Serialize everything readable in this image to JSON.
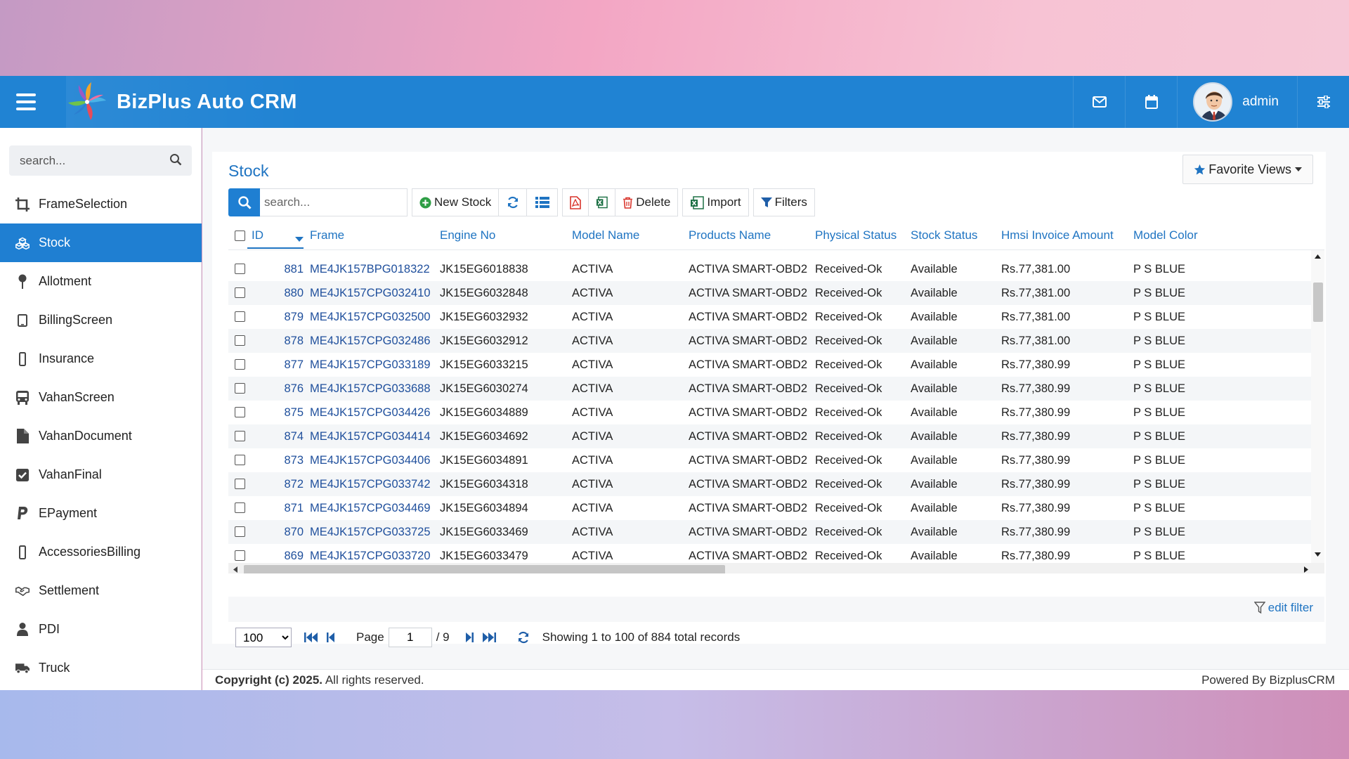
{
  "app": {
    "title": "BizPlus Auto CRM",
    "user": "admin"
  },
  "colors": {
    "primary": "#2083d3",
    "link": "#1f74c2"
  },
  "sidebar": {
    "search_placeholder": "search...",
    "items": [
      {
        "label": "FrameSelection",
        "icon": "crop-icon"
      },
      {
        "label": "Stock",
        "icon": "cubes-icon",
        "active": true
      },
      {
        "label": "Allotment",
        "icon": "pin-icon"
      },
      {
        "label": "BillingScreen",
        "icon": "tablet-icon"
      },
      {
        "label": "Insurance",
        "icon": "mobile-icon"
      },
      {
        "label": "VahanScreen",
        "icon": "bus-icon"
      },
      {
        "label": "VahanDocument",
        "icon": "file-icon"
      },
      {
        "label": "VahanFinal",
        "icon": "check-square-icon"
      },
      {
        "label": "EPayment",
        "icon": "paypal-icon"
      },
      {
        "label": "AccessoriesBilling",
        "icon": "mobile-icon"
      },
      {
        "label": "Settlement",
        "icon": "handshake-icon"
      },
      {
        "label": "PDI",
        "icon": "user-icon"
      },
      {
        "label": "Truck",
        "icon": "truck-icon"
      }
    ]
  },
  "main": {
    "title": "Stock",
    "favorite_views": "Favorite Views",
    "toolbar": {
      "search_placeholder": "search...",
      "new_stock": "New Stock",
      "delete": "Delete",
      "import": "Import",
      "filters": "Filters"
    },
    "columns": [
      "ID",
      "Frame",
      "Engine No",
      "Model Name",
      "Products Name",
      "Physical Status",
      "Stock Status",
      "Hmsi Invoice Amount",
      "Model Color"
    ],
    "rows": [
      {
        "id": "881",
        "frame": "ME4JK157BPG018322",
        "engine": "JK15EG6018838",
        "model": "ACTIVA",
        "product": "ACTIVA SMART-OBD2",
        "physical": "Received-Ok",
        "stock": "Available",
        "amount": "Rs.77,381.00",
        "color": "P S BLUE"
      },
      {
        "id": "880",
        "frame": "ME4JK157CPG032410",
        "engine": "JK15EG6032848",
        "model": "ACTIVA",
        "product": "ACTIVA SMART-OBD2",
        "physical": "Received-Ok",
        "stock": "Available",
        "amount": "Rs.77,381.00",
        "color": "P S BLUE"
      },
      {
        "id": "879",
        "frame": "ME4JK157CPG032500",
        "engine": "JK15EG6032932",
        "model": "ACTIVA",
        "product": "ACTIVA SMART-OBD2",
        "physical": "Received-Ok",
        "stock": "Available",
        "amount": "Rs.77,381.00",
        "color": "P S BLUE"
      },
      {
        "id": "878",
        "frame": "ME4JK157CPG032486",
        "engine": "JK15EG6032912",
        "model": "ACTIVA",
        "product": "ACTIVA SMART-OBD2",
        "physical": "Received-Ok",
        "stock": "Available",
        "amount": "Rs.77,381.00",
        "color": "P S BLUE"
      },
      {
        "id": "877",
        "frame": "ME4JK157CPG033189",
        "engine": "JK15EG6033215",
        "model": "ACTIVA",
        "product": "ACTIVA SMART-OBD2",
        "physical": "Received-Ok",
        "stock": "Available",
        "amount": "Rs.77,380.99",
        "color": "P S BLUE"
      },
      {
        "id": "876",
        "frame": "ME4JK157CPG033688",
        "engine": "JK15EG6030274",
        "model": "ACTIVA",
        "product": "ACTIVA SMART-OBD2",
        "physical": "Received-Ok",
        "stock": "Available",
        "amount": "Rs.77,380.99",
        "color": "P S BLUE"
      },
      {
        "id": "875",
        "frame": "ME4JK157CPG034426",
        "engine": "JK15EG6034889",
        "model": "ACTIVA",
        "product": "ACTIVA SMART-OBD2",
        "physical": "Received-Ok",
        "stock": "Available",
        "amount": "Rs.77,380.99",
        "color": "P S BLUE"
      },
      {
        "id": "874",
        "frame": "ME4JK157CPG034414",
        "engine": "JK15EG6034692",
        "model": "ACTIVA",
        "product": "ACTIVA SMART-OBD2",
        "physical": "Received-Ok",
        "stock": "Available",
        "amount": "Rs.77,380.99",
        "color": "P S BLUE"
      },
      {
        "id": "873",
        "frame": "ME4JK157CPG034406",
        "engine": "JK15EG6034891",
        "model": "ACTIVA",
        "product": "ACTIVA SMART-OBD2",
        "physical": "Received-Ok",
        "stock": "Available",
        "amount": "Rs.77,380.99",
        "color": "P S BLUE"
      },
      {
        "id": "872",
        "frame": "ME4JK157CPG033742",
        "engine": "JK15EG6034318",
        "model": "ACTIVA",
        "product": "ACTIVA SMART-OBD2",
        "physical": "Received-Ok",
        "stock": "Available",
        "amount": "Rs.77,380.99",
        "color": "P S BLUE"
      },
      {
        "id": "871",
        "frame": "ME4JK157CPG034469",
        "engine": "JK15EG6034894",
        "model": "ACTIVA",
        "product": "ACTIVA SMART-OBD2",
        "physical": "Received-Ok",
        "stock": "Available",
        "amount": "Rs.77,380.99",
        "color": "P S BLUE"
      },
      {
        "id": "870",
        "frame": "ME4JK157CPG033725",
        "engine": "JK15EG6033469",
        "model": "ACTIVA",
        "product": "ACTIVA SMART-OBD2",
        "physical": "Received-Ok",
        "stock": "Available",
        "amount": "Rs.77,380.99",
        "color": "P S BLUE"
      },
      {
        "id": "869",
        "frame": "ME4JK157CPG033720",
        "engine": "JK15EG6033479",
        "model": "ACTIVA",
        "product": "ACTIVA SMART-OBD2",
        "physical": "Received-Ok",
        "stock": "Available",
        "amount": "Rs.77,380.99",
        "color": "P S BLUE"
      }
    ],
    "edit_filter": "edit filter",
    "pager": {
      "page_size": "100",
      "page_label": "Page",
      "page": "1",
      "total_pages": "/ 9",
      "summary": "Showing 1 to 100 of 884 total records"
    }
  },
  "footer": {
    "copyright_bold": "Copyright (c) 2025.",
    "copyright_rest": " All rights reserved.",
    "powered": "Powered By BizplusCRM"
  }
}
